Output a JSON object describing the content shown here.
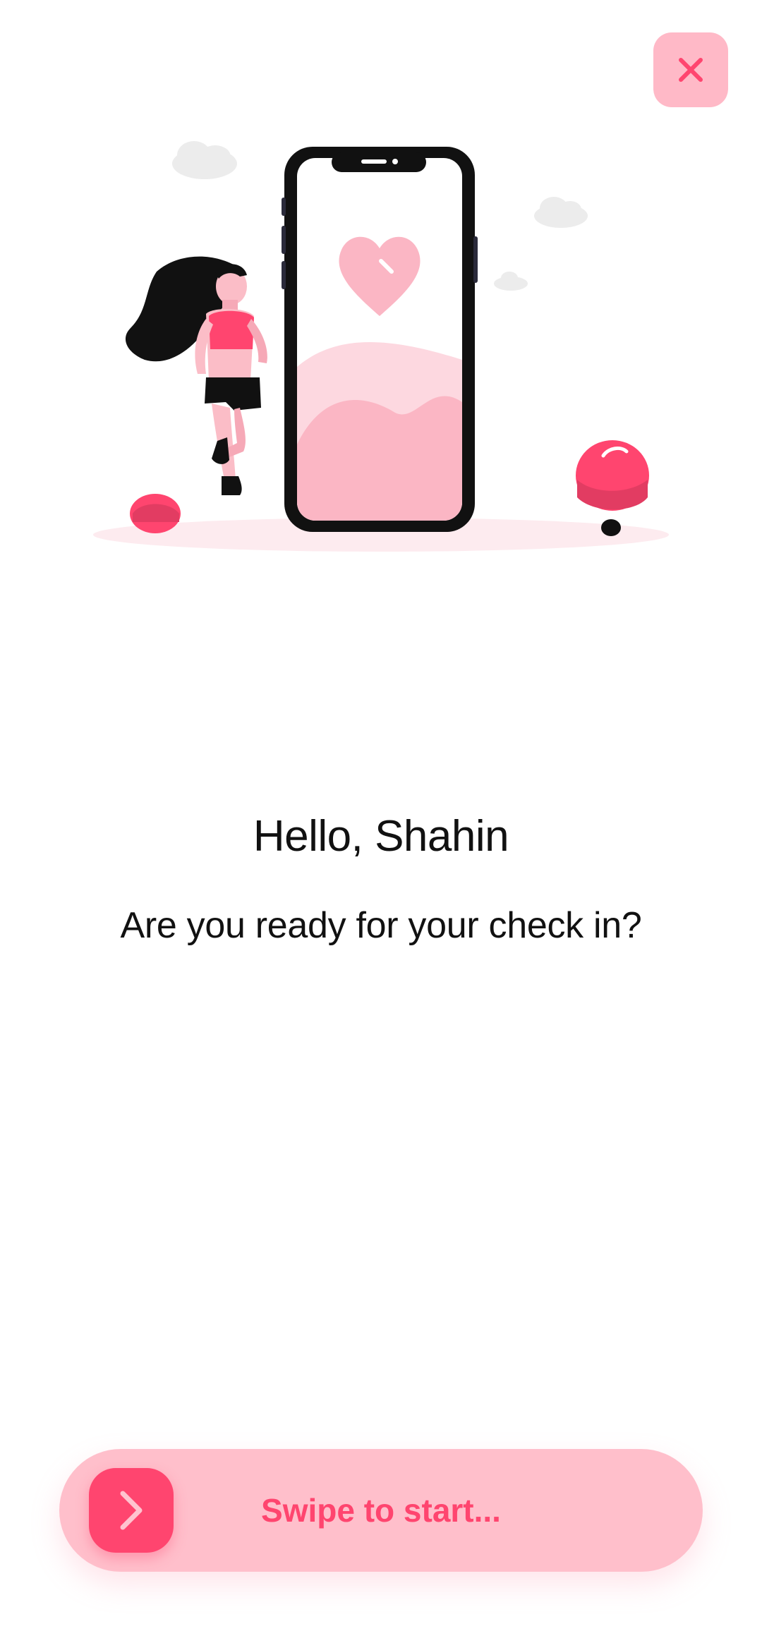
{
  "header": {
    "close_icon": "close-icon"
  },
  "illustration": {
    "description_icon": "runner-with-phone-heart-illustration"
  },
  "content": {
    "greeting": "Hello, Shahin",
    "question": "Are you ready for your check in?"
  },
  "swipe": {
    "label": "Swipe to start...",
    "handle_icon": "chevron-right-icon"
  },
  "colors": {
    "accent": "#ff456f",
    "accent_light": "#ffbfcb",
    "close_bg": "#ffb9c7",
    "text": "#111111",
    "background": "#ffffff"
  }
}
